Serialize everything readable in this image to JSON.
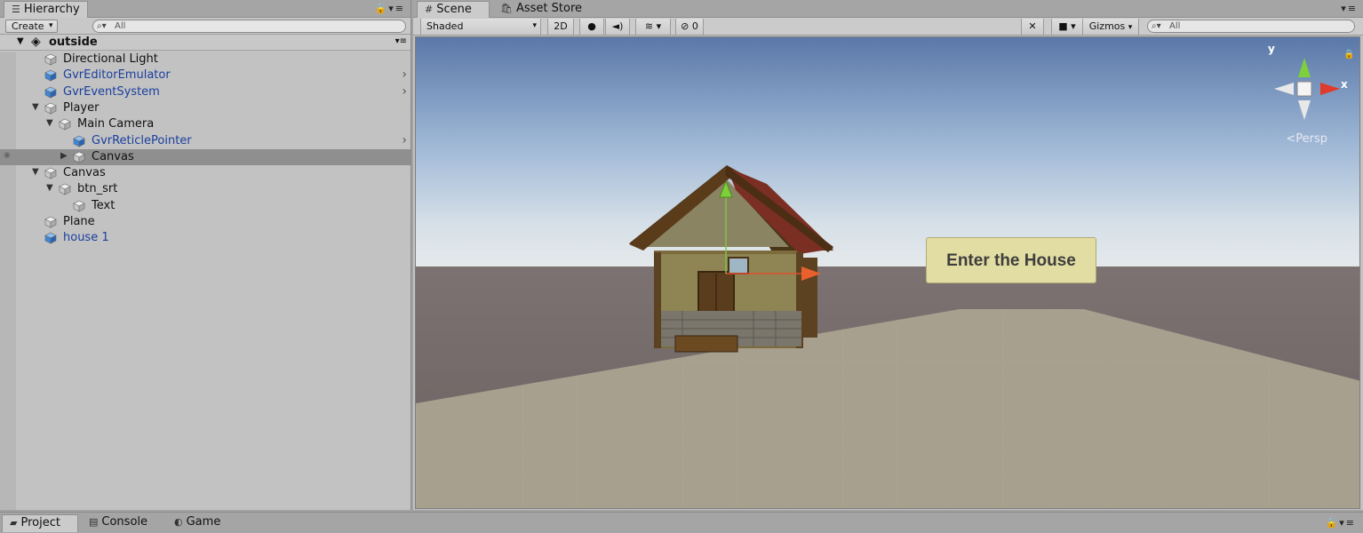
{
  "hierarchy": {
    "tab_label": "Hierarchy",
    "create_label": "Create",
    "search_placeholder": "All",
    "scene_name": "outside",
    "items": [
      {
        "label": "Directional Light",
        "blue": false
      },
      {
        "label": "GvrEditorEmulator",
        "blue": true
      },
      {
        "label": "GvrEventSystem",
        "blue": true
      },
      {
        "label": "Player",
        "blue": false
      },
      {
        "label": "Main Camera",
        "blue": false
      },
      {
        "label": "GvrReticlePointer",
        "blue": true
      },
      {
        "label": "Canvas",
        "blue": false
      },
      {
        "label": "Canvas",
        "blue": false
      },
      {
        "label": "btn_srt",
        "blue": false
      },
      {
        "label": "Text",
        "blue": false
      },
      {
        "label": "Plane",
        "blue": false
      },
      {
        "label": "house 1",
        "blue": true
      }
    ]
  },
  "scene": {
    "tabs": {
      "scene": "Scene",
      "asset_store": "Asset Store"
    },
    "shading_mode": "Shaded",
    "mode_2d": "2D",
    "hidden_count": "0",
    "gizmos_label": "Gizmos",
    "search_placeholder": "All",
    "persp_label": "Persp",
    "axis_y": "y",
    "axis_x": "x",
    "ui_button_text": "Enter the House"
  },
  "bottom_tabs": {
    "project": "Project",
    "console": "Console",
    "game": "Game"
  },
  "colors": {
    "selection": "#8f8f8f",
    "prefab_blue": "#1a3f9e",
    "button_fill": "#e2dda2"
  }
}
